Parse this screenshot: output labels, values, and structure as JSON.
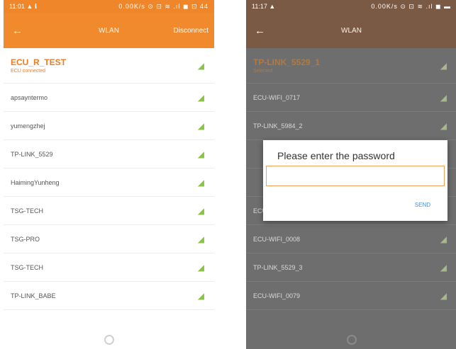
{
  "left": {
    "status": {
      "time": "11:01 ▲ ℹ",
      "icons": "0.00K/s ⊙ ⊡ ≋ .ıl ◼ ⊡ 44"
    },
    "title": "WLAN",
    "action": "Disconnect",
    "current": {
      "ssid": "ECU_R_TEST",
      "sub": "ECU connected"
    },
    "networks": [
      "apsayntermo",
      "yumengzhej",
      "TP-LINK_5529",
      "HaimingYunheng",
      "TSG-TECH",
      "TSG-PRO",
      "TSG-TECH",
      "TP-LINK_BABE"
    ]
  },
  "right": {
    "status": {
      "time": "11:17 ▲",
      "icons": "0.00K/s ⊙ ⊡ ≋ .ıl ◼ ▬"
    },
    "title": "WLAN",
    "current": {
      "ssid": "TP-LINK_5529_1",
      "sub": "Selected"
    },
    "networks": [
      "ECU-WIFI_0717",
      "TP-LINK_5984_2",
      "",
      "",
      "ECU-WIFI_0197",
      "ECU-WIFI_0008",
      "TP-LINK_5529_3",
      "ECU-WIFI_0079"
    ],
    "dialog": {
      "title": "Please enter the password",
      "input_value": "",
      "send": "SEND"
    }
  },
  "icons": {
    "back": "back-arrow-icon",
    "signal": "wifi-signal-icon",
    "home": "home-icon"
  },
  "colors": {
    "accent": "#f18a2c",
    "dialog_button": "#4a8ed8"
  }
}
